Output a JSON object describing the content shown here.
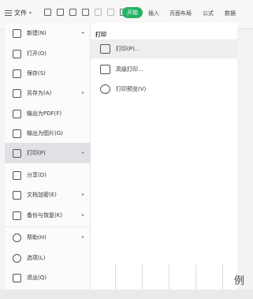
{
  "toolbar": {
    "file_label": "文件",
    "start_tab": "开始",
    "tabs": [
      "插入",
      "页面布局",
      "公式",
      "数据"
    ]
  },
  "left_menu": {
    "items": [
      {
        "label": "新建(N)",
        "icon": "new-file-icon",
        "has_arrow": true
      },
      {
        "label": "打开(O)",
        "icon": "folder-icon",
        "has_arrow": false
      },
      {
        "label": "保存(S)",
        "icon": "save-icon",
        "has_arrow": false
      },
      {
        "label": "另存为(A)",
        "icon": "save-as-icon",
        "has_arrow": true
      },
      {
        "label": "输出为PDF(F)",
        "icon": "pdf-icon",
        "has_arrow": false
      },
      {
        "label": "输出为图片(G)",
        "icon": "image-icon",
        "has_arrow": false
      },
      {
        "label": "打印(P)",
        "icon": "printer-icon",
        "has_arrow": true,
        "active": true
      },
      {
        "label": "分享(D)",
        "icon": "share-icon",
        "has_arrow": false
      },
      {
        "label": "文档加密(E)",
        "icon": "lock-icon",
        "has_arrow": true
      },
      {
        "label": "备份与恢复(K)",
        "icon": "backup-icon",
        "has_arrow": true
      },
      {
        "label": "帮助(H)",
        "icon": "help-icon",
        "has_arrow": true
      },
      {
        "label": "选项(L)",
        "icon": "gear-icon",
        "has_arrow": false
      },
      {
        "label": "退出(Q)",
        "icon": "exit-icon",
        "has_arrow": false
      }
    ]
  },
  "print_panel": {
    "header": "打印",
    "items": [
      {
        "label": "打印(P)...",
        "icon": "printer-icon"
      },
      {
        "label": "高级打印...",
        "icon": "advanced-print-icon"
      },
      {
        "label": "打印预览(V)",
        "icon": "print-preview-icon"
      }
    ]
  },
  "corner_text": "例"
}
